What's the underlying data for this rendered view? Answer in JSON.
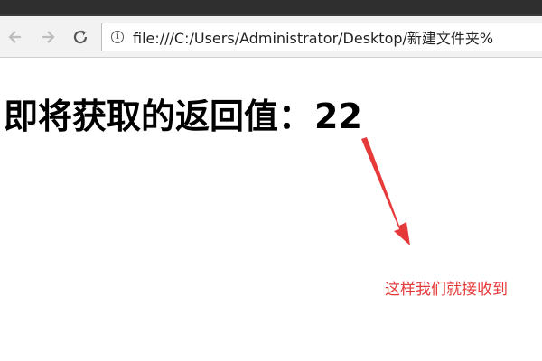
{
  "browser": {
    "url": "file:///C:/Users/Administrator/Desktop/新建文件夹%",
    "icons": {
      "back": "arrow-left-icon",
      "forward": "arrow-right-icon",
      "reload": "reload-icon",
      "info": "info-icon"
    }
  },
  "page": {
    "heading_label": "即将获取的返回值：",
    "heading_value": "22",
    "annotation_text": "这样我们就接收到",
    "annotation_color": "#e63a3a"
  }
}
